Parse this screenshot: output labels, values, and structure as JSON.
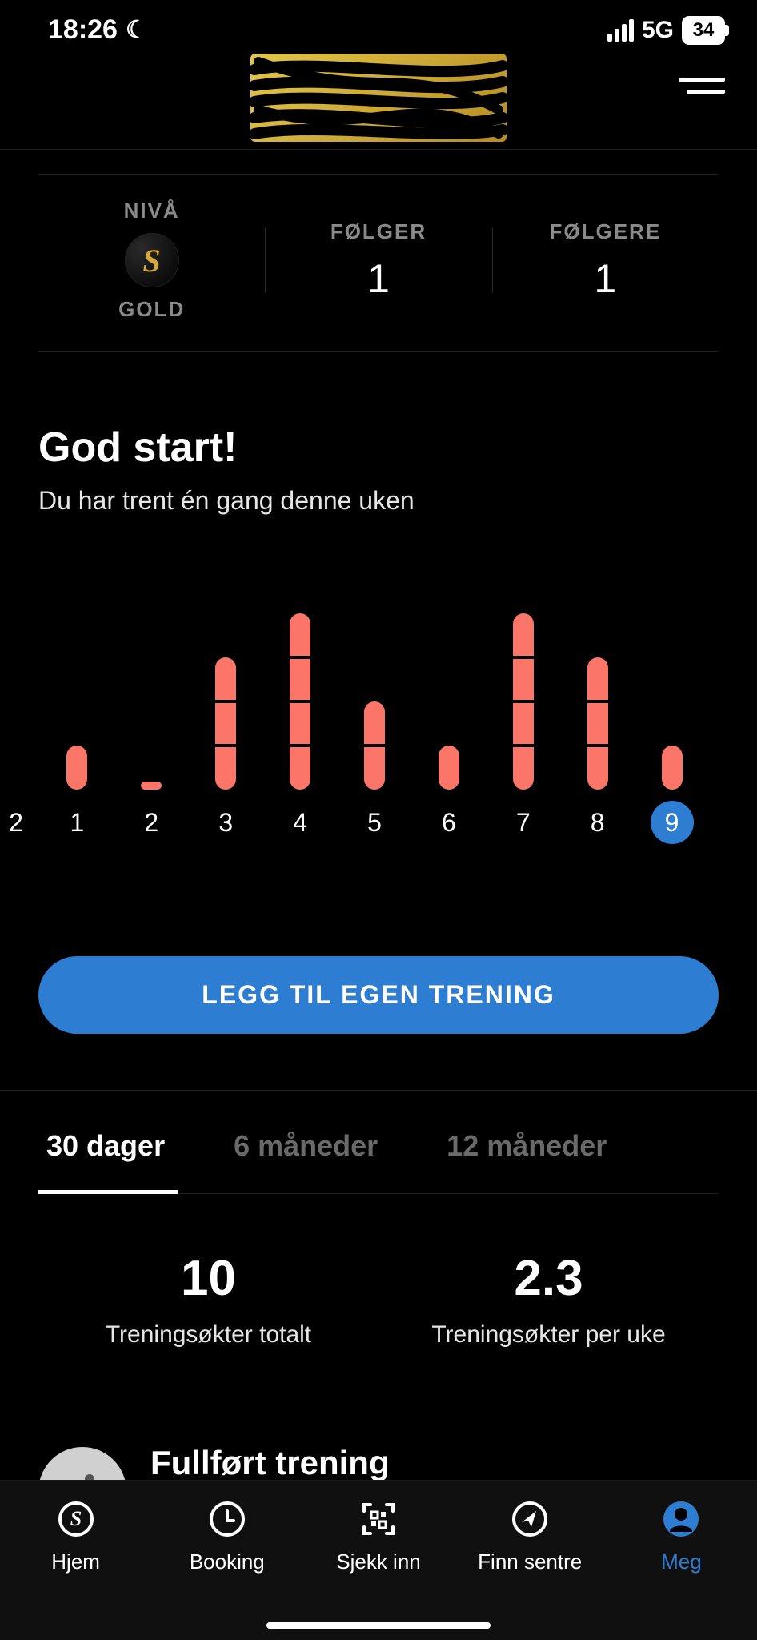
{
  "status_bar": {
    "time": "18:26",
    "network": "5G",
    "battery": "34"
  },
  "header": {
    "level_label": "NIVÅ",
    "level_tier": "GOLD",
    "level_glyph": "S",
    "following_label": "FØLGER",
    "following_count": "1",
    "followers_label": "FØLGERE",
    "followers_count": "1"
  },
  "greeting": {
    "title": "God start!",
    "subtitle": "Du har trent én gang denne uken"
  },
  "chart_data": {
    "type": "bar",
    "categories": [
      "2",
      "1",
      "2",
      "3",
      "4",
      "5",
      "6",
      "7",
      "8",
      "9"
    ],
    "values": [
      0,
      1,
      0,
      3,
      4,
      2,
      1,
      4,
      3,
      1
    ],
    "active_index": 9,
    "ylim": [
      0,
      4
    ]
  },
  "cta_label": "LEGG TIL EGEN TRENING",
  "tabs": [
    {
      "label": "30 dager",
      "active": true
    },
    {
      "label": "6 måneder",
      "active": false
    },
    {
      "label": "12 måneder",
      "active": false
    }
  ],
  "metrics": {
    "total_sessions_value": "10",
    "total_sessions_label": "Treningsøkter totalt",
    "per_week_value": "2.3",
    "per_week_label": "Treningsøkter per uke"
  },
  "completed": {
    "title": "Fullført trening"
  },
  "bottom_nav": [
    {
      "label": "Hjem"
    },
    {
      "label": "Booking"
    },
    {
      "label": "Sjekk inn"
    },
    {
      "label": "Finn sentre"
    },
    {
      "label": "Meg"
    }
  ]
}
